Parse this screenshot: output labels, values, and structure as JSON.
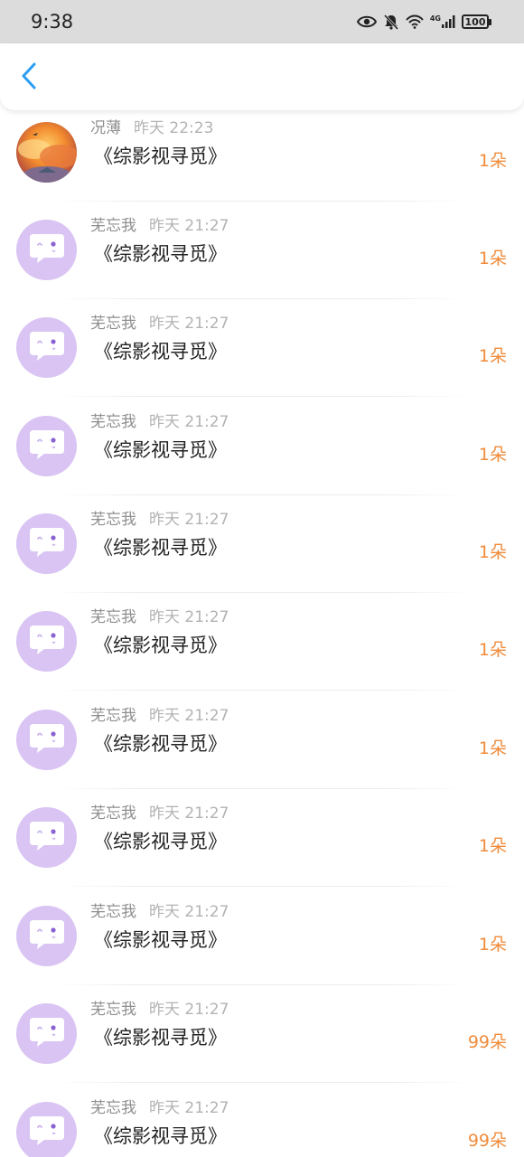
{
  "status_bar": {
    "time": "9:38",
    "battery": "100",
    "network": "4G"
  },
  "header": {
    "back_icon": "chevron-left-icon"
  },
  "messages": [
    {
      "name": "况薄",
      "time": "昨天 22:23",
      "title": "《综影视寻觅》",
      "count": "1朵",
      "avatar": "photo-avatar"
    },
    {
      "name": "芜忘我",
      "time": "昨天 21:27",
      "title": "《综影视寻觅》",
      "count": "1朵",
      "avatar": "chat-bot-icon"
    },
    {
      "name": "芜忘我",
      "time": "昨天 21:27",
      "title": "《综影视寻觅》",
      "count": "1朵",
      "avatar": "chat-bot-icon"
    },
    {
      "name": "芜忘我",
      "time": "昨天 21:27",
      "title": "《综影视寻觅》",
      "count": "1朵",
      "avatar": "chat-bot-icon"
    },
    {
      "name": "芜忘我",
      "time": "昨天 21:27",
      "title": "《综影视寻觅》",
      "count": "1朵",
      "avatar": "chat-bot-icon"
    },
    {
      "name": "芜忘我",
      "time": "昨天 21:27",
      "title": "《综影视寻觅》",
      "count": "1朵",
      "avatar": "chat-bot-icon"
    },
    {
      "name": "芜忘我",
      "time": "昨天 21:27",
      "title": "《综影视寻觅》",
      "count": "1朵",
      "avatar": "chat-bot-icon"
    },
    {
      "name": "芜忘我",
      "time": "昨天 21:27",
      "title": "《综影视寻觅》",
      "count": "1朵",
      "avatar": "chat-bot-icon"
    },
    {
      "name": "芜忘我",
      "time": "昨天 21:27",
      "title": "《综影视寻觅》",
      "count": "1朵",
      "avatar": "chat-bot-icon"
    },
    {
      "name": "芜忘我",
      "time": "昨天 21:27",
      "title": "《综影视寻觅》",
      "count": "99朵",
      "avatar": "chat-bot-icon"
    },
    {
      "name": "芜忘我",
      "time": "昨天 21:27",
      "title": "《综影视寻觅》",
      "count": "99朵",
      "avatar": "chat-bot-icon"
    }
  ],
  "colors": {
    "accent": "#2a9df4",
    "count": "#f08c3c",
    "avatar_bg": "#d9c4f3"
  }
}
